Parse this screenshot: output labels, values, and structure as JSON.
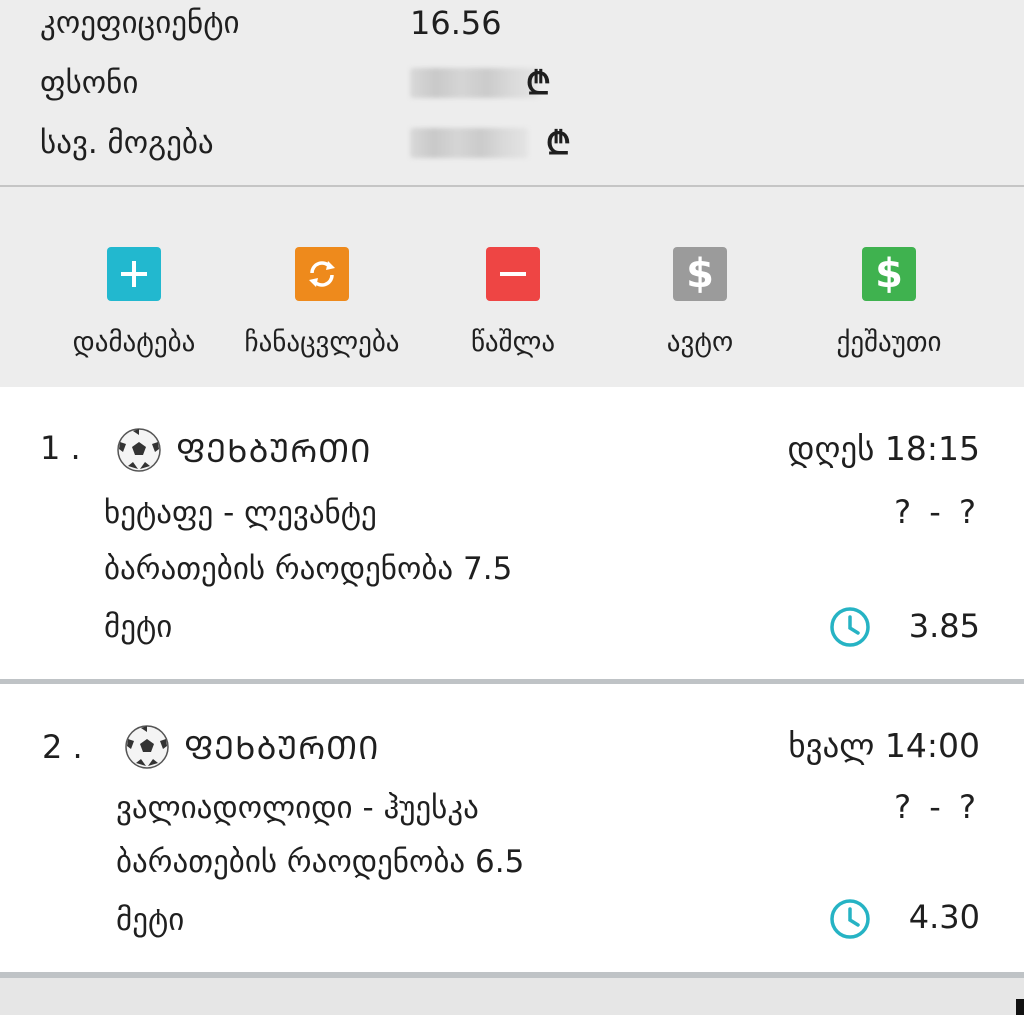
{
  "summary": {
    "odds_label": "კოეფიციენტი",
    "odds_value": "16.56",
    "stake_label": "ფსონი",
    "stake_currency": "₾",
    "winnings_label": "სავ. მოგება",
    "winnings_currency": "₾"
  },
  "toolbar": {
    "buttons": [
      {
        "label": "დამატება",
        "icon": "plus-icon",
        "color": "#22b8cf"
      },
      {
        "label": "ჩანაცვლება",
        "icon": "refresh-icon",
        "color": "#ee8a1c"
      },
      {
        "label": "წაშლა",
        "icon": "minus-icon",
        "color": "#ee4544"
      },
      {
        "label": "ავტო",
        "icon": "dollar-icon",
        "color": "#9b9b9b"
      },
      {
        "label": "ქეშაუთი",
        "icon": "dollar-icon",
        "color": "#3fb24f"
      }
    ]
  },
  "bets": [
    {
      "index": "1 .",
      "sport": "ᲤᲔᲮᲑᲣᲠᲗᲘ",
      "time": "დღეს 18:15",
      "teams": "ხეტაფე - ლევანტე",
      "score": "? - ?",
      "market": "ბარათების რაოდენობა 7.5",
      "pick": "მეტი",
      "odds": "3.85"
    },
    {
      "index": "2 .",
      "sport": "ᲤᲔᲮᲑᲣᲠᲗᲘ",
      "time": "ხვალ 14:00",
      "teams": "ვალიადოლიდი - ჰუესკა",
      "score": "? - ?",
      "market": "ბარათების რაოდენობა 6.5",
      "pick": "მეტი",
      "odds": "4.30"
    }
  ],
  "colors": {
    "clock_accent": "#26b3c4",
    "background": "#ededed",
    "card": "#ffffff"
  }
}
